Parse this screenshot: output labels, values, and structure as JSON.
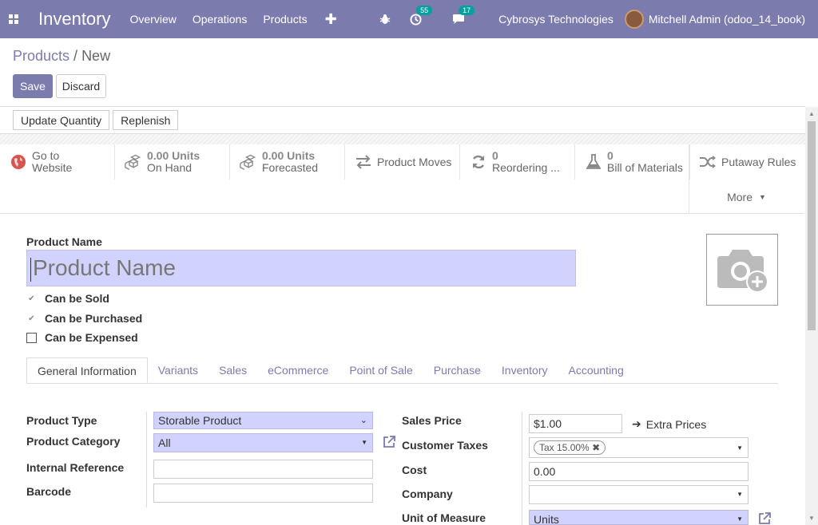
{
  "navbar": {
    "app_name": "Inventory",
    "menu": [
      "Overview",
      "Operations",
      "Products"
    ],
    "plus": "✚",
    "activity_count": "55",
    "message_count": "17",
    "company": "Cybrosys Technologies",
    "user": "Mitchell Admin (odoo_14_book)"
  },
  "breadcrumb": {
    "parent": "Products",
    "separator": " / ",
    "current": "New"
  },
  "actions": {
    "save": "Save",
    "discard": "Discard"
  },
  "header_buttons": [
    "Update Quantity",
    "Replenish"
  ],
  "smart_buttons": {
    "website": {
      "line1": "Go to",
      "line2": "Website"
    },
    "on_hand": {
      "value": "0.00 Units",
      "label": "On Hand"
    },
    "forecasted": {
      "value": "0.00 Units",
      "label": "Forecasted"
    },
    "moves": {
      "label": "Product Moves"
    },
    "reordering": {
      "value": "0",
      "label": "Reordering ..."
    },
    "bom": {
      "value": "0",
      "label": "Bill of Materials"
    },
    "putaway": {
      "label": "Putaway Rules"
    },
    "more": "More"
  },
  "form": {
    "name_label": "Product Name",
    "name_placeholder": "Product Name",
    "can_be_sold": "Can be Sold",
    "can_be_purchased": "Can be Purchased",
    "can_be_expensed": "Can be Expensed"
  },
  "tabs": [
    "General Information",
    "Variants",
    "Sales",
    "eCommerce",
    "Point of Sale",
    "Purchase",
    "Inventory",
    "Accounting"
  ],
  "general": {
    "product_type_label": "Product Type",
    "product_type_value": "Storable Product",
    "product_category_label": "Product Category",
    "product_category_value": "All",
    "internal_reference_label": "Internal Reference",
    "barcode_label": "Barcode",
    "sales_price_label": "Sales Price",
    "sales_price_value": "$1.00",
    "extra_prices": "Extra Prices",
    "customer_taxes_label": "Customer Taxes",
    "customer_taxes_tag": "Tax 15.00%",
    "cost_label": "Cost",
    "cost_value": "0.00",
    "company_label": "Company",
    "uom_label": "Unit of Measure",
    "uom_value": "Units"
  }
}
